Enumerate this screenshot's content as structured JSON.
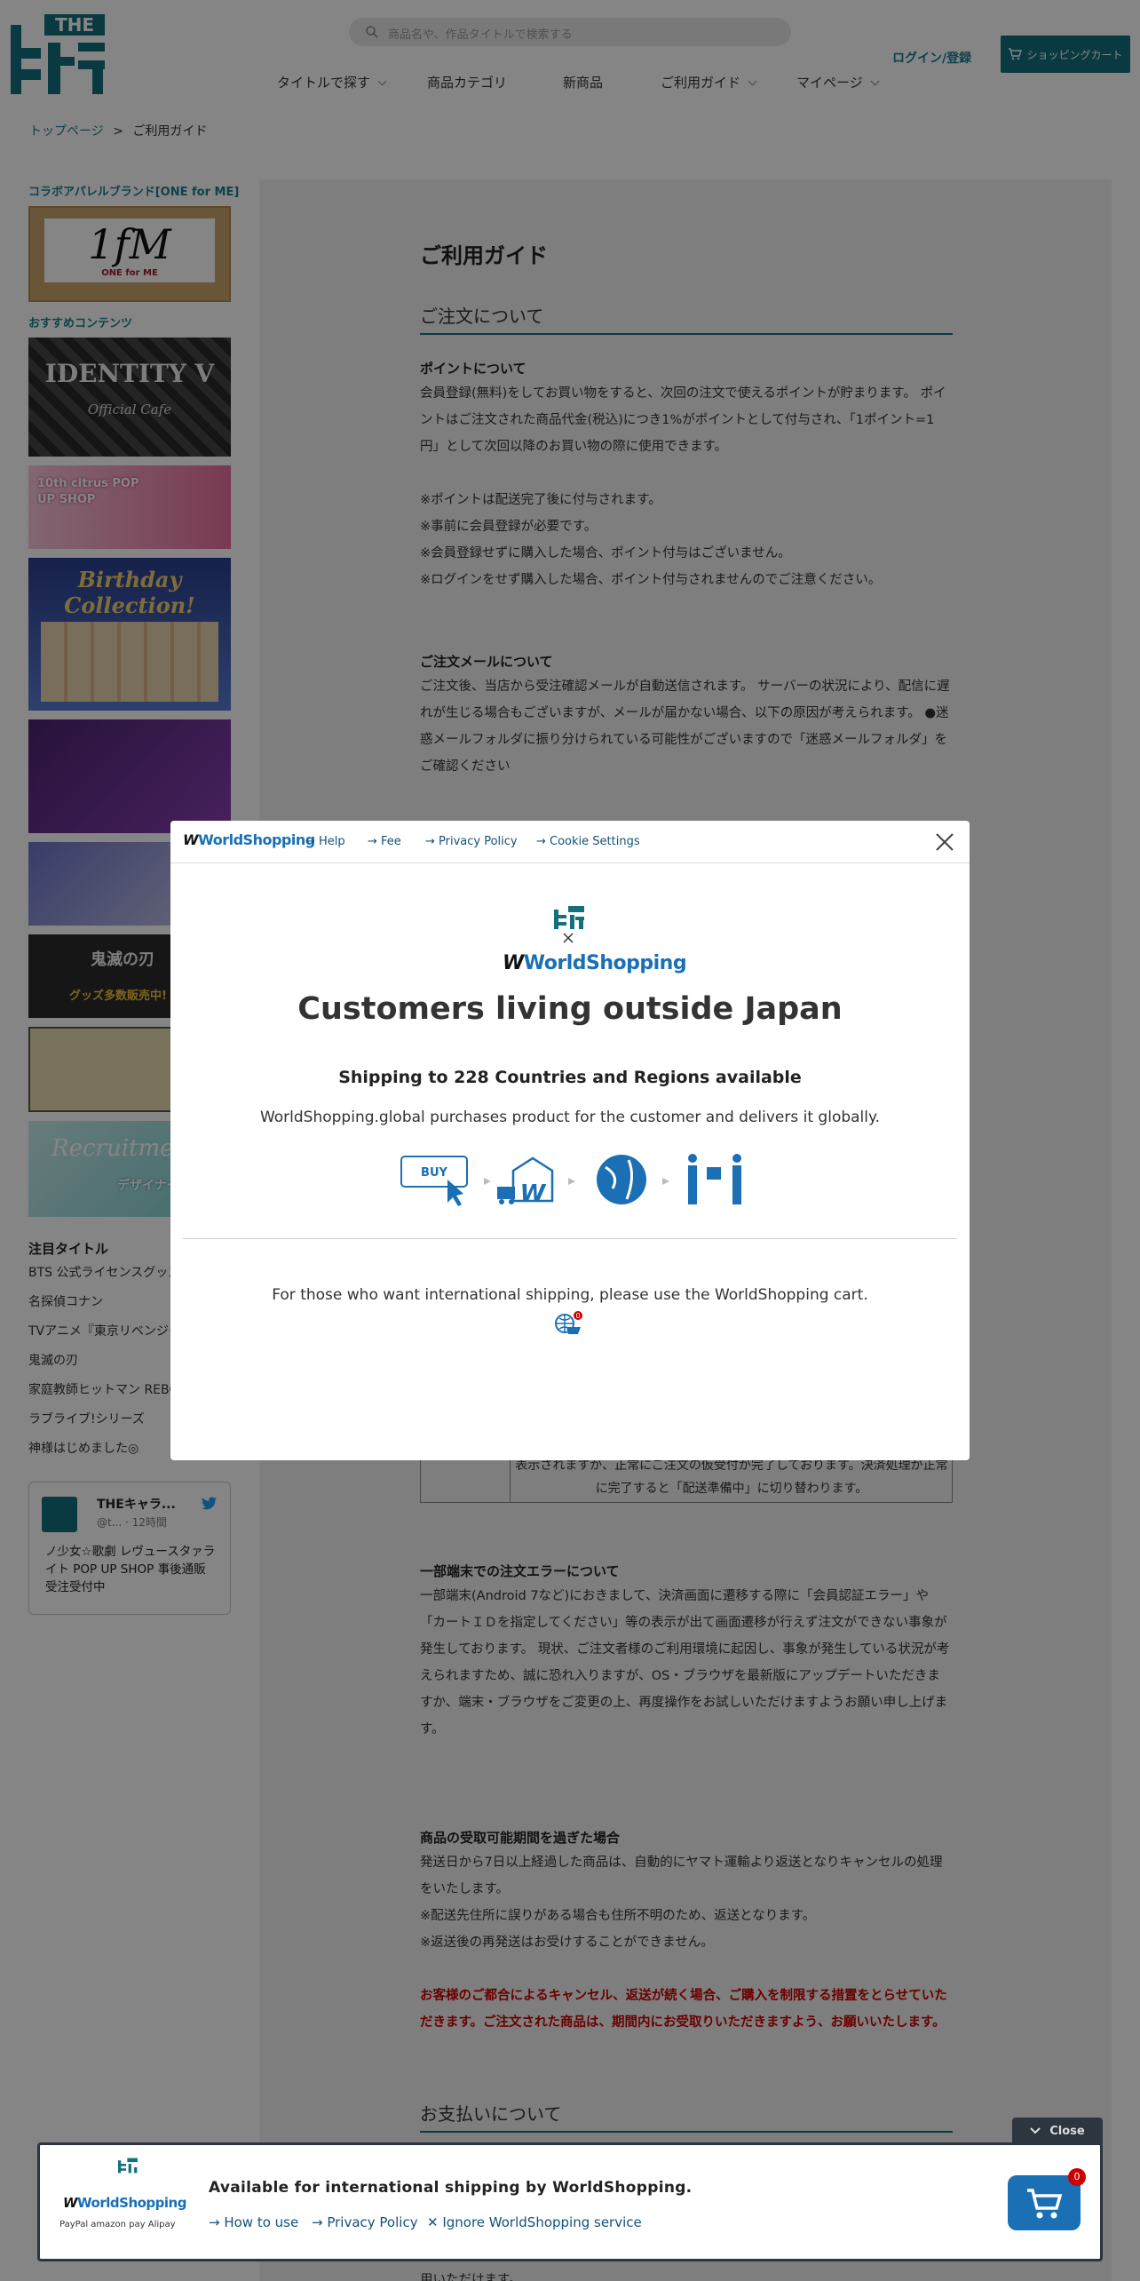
{
  "header": {
    "logo_text": "THE キャラ",
    "search_placeholder": "商品名や、作品タイトルで検索する",
    "nav": [
      "タイトルで探す",
      "商品カテゴリ",
      "新商品",
      "ご利用ガイド",
      "マイページ"
    ],
    "login": "ログイン/登録",
    "cart": "ショッピングカート"
  },
  "breadcrumb": {
    "home": "トップページ",
    "sep": ">",
    "current": "ご利用ガイド"
  },
  "sidebar": {
    "collab_title": "コラボアパレルブランド[ONE for ME]",
    "recommend_title": "おすすめコンテンツ",
    "banners": {
      "onefor": "1fM",
      "onefor_sub": "ONE for ME",
      "identity": "IDENTITY V",
      "identity_sub": "Official Cafe",
      "citrus": "10th citrus POP UP SHOP",
      "birthday": "Birthday Collection!",
      "kimetsu": "鬼滅の刃",
      "kimetsu_sub": "グッズ多数販売中!",
      "recruit": "Recruitment",
      "recruit_sub": "デザイナー募集中!"
    },
    "hot_title": "注目タイトル",
    "hot_links": [
      "BTS 公式ライセンスグッズ",
      "名探偵コナン",
      "TVアニメ『東京リベンジャーズ』",
      "鬼滅の刃",
      "家庭教師ヒットマン REBORN!",
      "ラブライブ!シリーズ",
      "神様はじめました◎"
    ],
    "tweet": {
      "name": "THEキャラ...",
      "handle": "@t... · 12時間",
      "body": "ノ少女☆歌劇 レヴュースタァライト POP UP SHOP 事後通販　受注受付中"
    }
  },
  "main": {
    "title": "ご利用ガイド",
    "sec_order": "ご注文について",
    "points_title": "ポイントについて",
    "points_body": "会員登録(無料)をしてお買い物をすると、次回の注文で使えるポイントが貯まります。 ポイントはご注文された商品代金(税込)につき1%がポイントとして付与され、「1ポイント=1円」として次回以降のお買い物の際に使用できます。",
    "points_notes": [
      "※ポイントは配送完了後に付与されます。",
      "※事前に会員登録が必要です。",
      "※会員登録せずに購入した場合、ポイント付与はございません。",
      "※ログインをせず購入した場合、ポイント付与されませんのでご注意ください。"
    ],
    "mail_title": "ご注文メールについて",
    "mail_body": "ご注文後、当店から受注確認メールが自動送信されます。 サーバーの状況により、配信に遅れが生じる場合もございますが、メールが届かない場合、以下の原因が考えられます。 ●迷惑メールフォルダに振り分けられている可能性がございますので「迷惑メールフォルダ」をご確認ください",
    "table_text": "表示されますが、正常にご注文の仮受付が完了しております。決済処理が正常に完了すると「配送準備中」に切り替わります。",
    "error_title": "一部端末での注文エラーについて",
    "error_body": "一部端末(Android 7など)におきまして、決済画面に遷移する際に「会員認証エラー」や「カートＩＤを指定してください」等の表示が出て画面遷移が行えず注文ができない事象が発生しております。 現状、ご注文者様のご利用環境に起因し、事象が発生している状況が考えられますため、誠に恐れ入りますが、OS・ブラウザを最新版にアップデートいただきますか、端末・ブラウザをご変更の上、再度操作をお試しいただけますようお願い申し上げます。",
    "return_title": "商品の受取可能期間を過ぎた場合",
    "return_body": "発送日から7日以上経過した商品は、自動的にヤマト運輸より返送となりキャンセルの処理をいたします。",
    "return_notes": [
      "※配送先住所に誤りがある場合も住所不明のため、返送となります。",
      "※返送後の再発送はお受けすることができません。"
    ],
    "warning": "お客様のご都合によるキャンセル、返送が続く場合、ご購入を制限する措置をとらせていただきます。ご注文された商品は、期間内にお受取りいただきますよう、お願いいたします。",
    "sec_pay": "お支払いについて",
    "pay_tail": "用いただけます。"
  },
  "modal": {
    "logo": "WorldShopping",
    "links": [
      "Help",
      "Fee",
      "Privacy Policy",
      "Cookie Settings"
    ],
    "title": "Customers living outside Japan",
    "subtitle": "Shipping to 228 Countries and Regions available",
    "desc": "WorldShopping.global purchases product for the customer and delivers it globally.",
    "flow_buy": "BUY",
    "footer": "For those who want international shipping, please use the WorldShopping cart.",
    "cart_count": "0"
  },
  "ws_bar": {
    "close": "Close",
    "logo": "WorldShopping",
    "payments": "PayPal  amazon pay  Alipay",
    "title": "Available for international shipping by WorldShopping.",
    "links": [
      "How to use",
      "Privacy Policy",
      "Ignore WorldShopping service"
    ],
    "cart_count": "0"
  },
  "colors": {
    "teal": "#14707e",
    "link": "#1a7f8e",
    "ws_blue": "#1a6fb5",
    "warning": "#cc0000"
  }
}
